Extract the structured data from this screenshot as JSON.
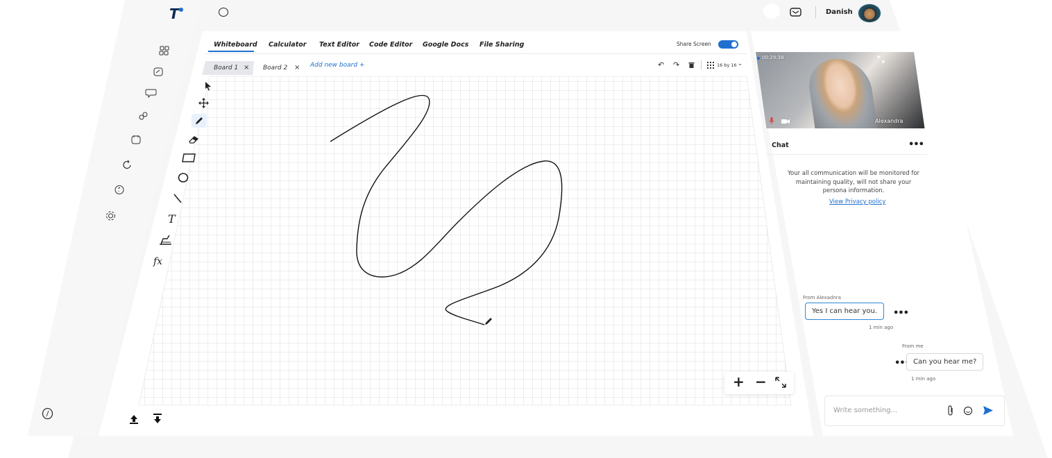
{
  "app": {
    "logo_letter": "T",
    "brand_color": "#1f6fd1",
    "header_icon": "circle-icon",
    "user_name": "Danish",
    "header_icons": [
      "dot-icon",
      "mail-icon"
    ]
  },
  "tabs": [
    "Whiteboard",
    "Calculator",
    "Text Editor",
    "Code Editor",
    "Google Docs",
    "File Sharing"
  ],
  "active_tab": "Whiteboard",
  "share_screen": {
    "label": "Share Screen",
    "on": true
  },
  "boards": {
    "items": [
      "Board 1",
      "Board 2"
    ],
    "add_label": "Add new board +",
    "grid_label": "16 by 16"
  },
  "sidebar_icons": [
    "apps-icon",
    "whiteboard-icon",
    "chat-icon",
    "users-icon",
    "calendar-icon",
    "refresh-icon",
    "help-icon",
    "settings-icon"
  ],
  "bottom_left_icon": "logout-icon",
  "tools": [
    "select-icon",
    "move-icon",
    "pen-icon",
    "eraser-icon",
    "rectangle-icon",
    "circle-icon",
    "line-icon",
    "text-icon",
    "graph-icon",
    "function-icon"
  ],
  "tool_labels": {
    "text": "T",
    "function": "fx"
  },
  "zoom_controls": {
    "zoom_in": "+",
    "zoom_out": "−"
  },
  "video": {
    "timer": "00:29:38",
    "participant": "Alexandra"
  },
  "chat": {
    "title": "Chat",
    "notice": "Your all communication will be monitored for maintaining quality, will not share your persona information.",
    "privacy_link": "View Privacy policy",
    "messages": [
      {
        "from": "From Alexadnra",
        "text": "Yes I can hear you.",
        "time": "1 min ago"
      },
      {
        "from": "From me",
        "text": "Can you hear me?",
        "time": "1 min ago"
      }
    ],
    "input_placeholder": "Write something..."
  }
}
